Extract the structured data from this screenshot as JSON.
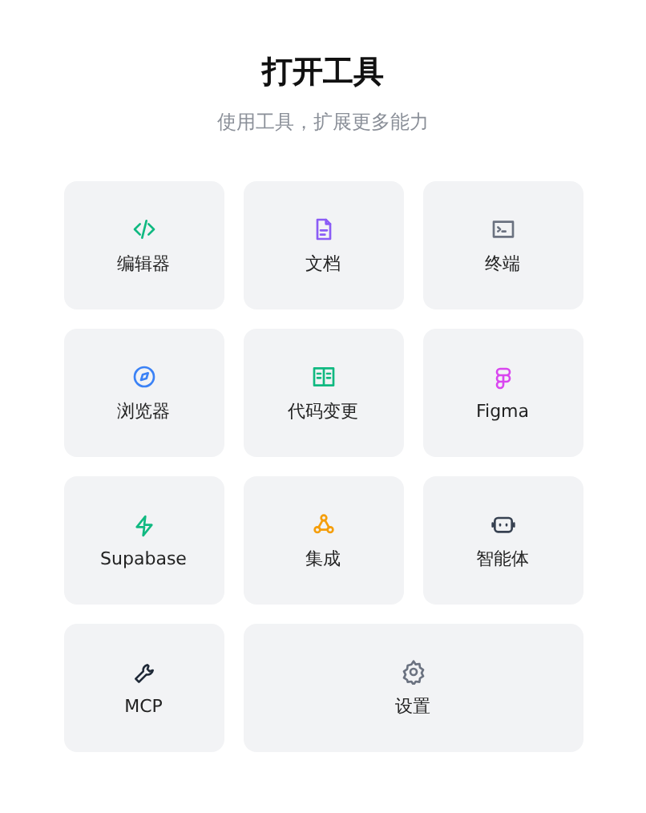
{
  "title": "打开工具",
  "subtitle": "使用工具，扩展更多能力",
  "tools": [
    {
      "label": "编辑器",
      "kind": "code",
      "color": "#10b981",
      "wide": false
    },
    {
      "label": "文档",
      "kind": "document",
      "color": "#8b5cf6",
      "wide": false
    },
    {
      "label": "终端",
      "kind": "terminal",
      "color": "#6b7280",
      "wide": false
    },
    {
      "label": "浏览器",
      "kind": "compass",
      "color": "#3b82f6",
      "wide": false
    },
    {
      "label": "代码变更",
      "kind": "book",
      "color": "#10b981",
      "wide": false
    },
    {
      "label": "Figma",
      "kind": "figma",
      "color": "#d946ef",
      "wide": false
    },
    {
      "label": "Supabase",
      "kind": "bolt",
      "color": "#10b981",
      "wide": false
    },
    {
      "label": "集成",
      "kind": "nodes",
      "color": "#f59e0b",
      "wide": false
    },
    {
      "label": "智能体",
      "kind": "bot",
      "color": "#374151",
      "wide": false
    },
    {
      "label": "MCP",
      "kind": "wrench",
      "color": "#1f2937",
      "wide": false
    },
    {
      "label": "设置",
      "kind": "gear",
      "color": "#6b7280",
      "wide": true
    }
  ]
}
